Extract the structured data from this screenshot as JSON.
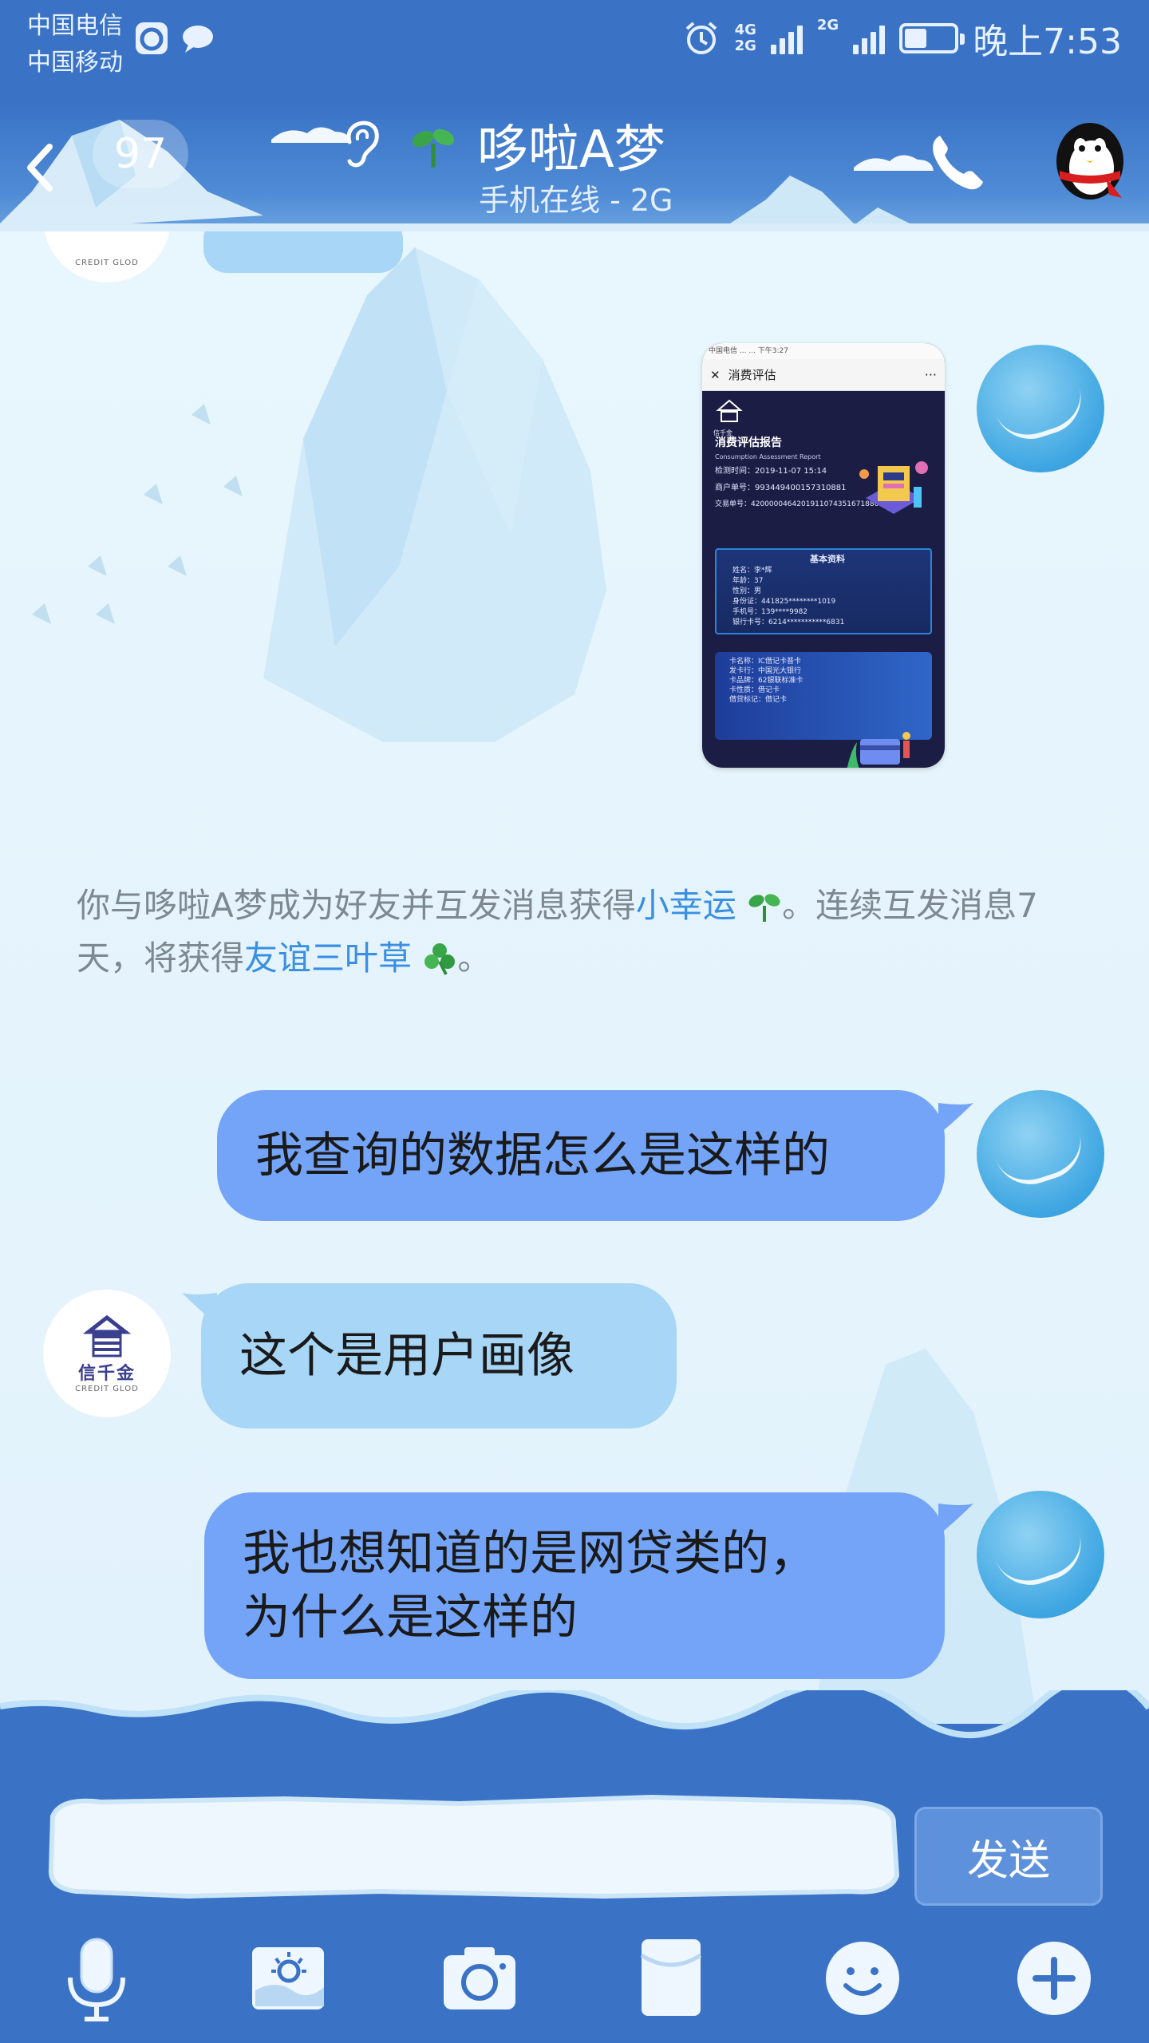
{
  "status_bar": {
    "carrier_1": "中国电信",
    "carrier_2": "中国移动",
    "net_1_top": "4G",
    "net_1_bottom": "2G",
    "net_2": "2G",
    "battery_level_pct": 45,
    "time": "晚上7:53"
  },
  "header": {
    "unread_count": "97",
    "contact_name": "哆啦A梦",
    "contact_status": "手机在线 - 2G"
  },
  "shared_image": {
    "status_text": "中国电信 ...   ... 下午3:27",
    "header_title": "消费评估",
    "more_label": "···",
    "brand": "信千金",
    "report_title": "消费评估报告",
    "report_subtitle": "Consumption Assessment Report",
    "lines": [
      "检测时间：2019-11-07 15:14",
      "商户单号：99344940015731​0881",
      "交易单号：4200000464201911074351671886"
    ],
    "basic_title": "基本资料",
    "basic_lines": [
      "姓名：李*辉",
      "年龄：37",
      "性别：男",
      "身份证：441825********1019",
      "手机号：139****9982",
      "银行卡号：6214***********6831"
    ],
    "card_lines": [
      "卡名称：IC借记卡普卡",
      "发卡行：中国光大银行",
      "卡品牌：62银联标准卡",
      "卡性质：借记卡",
      "借贷标记：借记卡"
    ]
  },
  "system_message": {
    "part1": "你与哆啦A梦成为好友并互发消息获得",
    "link1": "小幸运",
    "part2": "。连续互发消息7天，将获得",
    "link2": "友谊三叶草",
    "part3": "。"
  },
  "messages": [
    {
      "sender": "me",
      "text": "我查询的数据怎么是这样的"
    },
    {
      "sender": "other",
      "text": "这个是用户画像"
    },
    {
      "sender": "me",
      "text_line1": "我也想知道的是网贷类的，",
      "text_line2": "为什么是这样的"
    }
  ],
  "other_avatar": {
    "brand": "信千金",
    "sub": "CREDIT GLOD"
  },
  "composer": {
    "input_value": "",
    "send_label": "发送"
  },
  "colors": {
    "brand_blue": "#3a73c6",
    "my_bubble": "#74a4f8",
    "other_bubble": "#a8d6f6",
    "link": "#3a8fe2"
  },
  "toolbar_icons": [
    "microphone-icon",
    "picture-icon",
    "camera-icon",
    "red-packet-icon",
    "emoji-icon",
    "plus-icon"
  ]
}
